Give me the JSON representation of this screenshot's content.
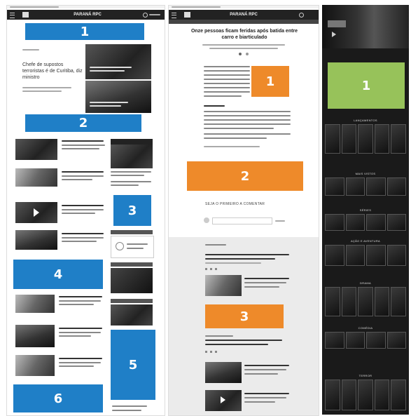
{
  "panel1": {
    "logo": "PARANÁ RPC",
    "headline": "Chefe de supostos terroristas é de Curitiba, diz ministro",
    "ad_labels": [
      "1",
      "2",
      "3",
      "4",
      "5",
      "6"
    ]
  },
  "panel2": {
    "logo": "PARANÁ RPC",
    "headline": "Onze pessoas ficam feridas após batida entre carro e biarticulado",
    "comment_prompt": "SEJA O PRIMEIRO A COMENTAR",
    "ad_labels": [
      "1",
      "2",
      "3"
    ]
  },
  "panel3": {
    "ad_labels": [
      "1"
    ],
    "section_titles": [
      "LANÇAMENTOS",
      "MAIS VISTOS",
      "SÉRIES",
      "AÇÃO E AVENTURA",
      "DRAMA",
      "COMÉDIA",
      "TERROR"
    ]
  },
  "colors": {
    "ad_blue": "#1f7fc7",
    "ad_orange": "#ee8a2a",
    "ad_green": "#97c25a",
    "dark_bg": "#1a1a1a"
  }
}
